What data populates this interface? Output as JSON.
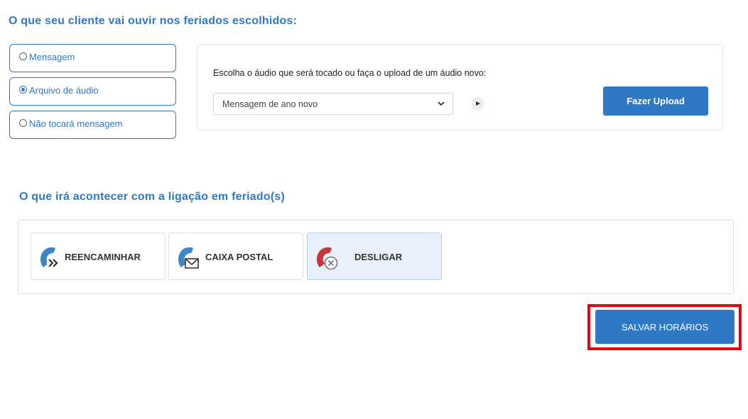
{
  "section_audio": {
    "heading": "O que seu cliente vai ouvir nos feriados escolhidos:",
    "options": [
      {
        "label": "Mensagem",
        "selected": false
      },
      {
        "label": "Arquivo de áudio",
        "selected": true
      },
      {
        "label": "Não tocará mensagem",
        "selected": false
      }
    ],
    "audio_prompt": "Escolha o áudio que será tocado ou faça o upload de um áudio novo:",
    "audio_select_value": "Mensagem de ano novo",
    "upload_label": "Fazer Upload"
  },
  "section_call": {
    "heading": "O que irá acontecer com a ligação em feriado(s)",
    "actions": [
      {
        "label": "REENCAMINHAR",
        "icon": "phone-forward-icon",
        "selected": false
      },
      {
        "label": "CAIXA POSTAL",
        "icon": "phone-mail-icon",
        "selected": false
      },
      {
        "label": "DESLIGAR",
        "icon": "phone-hangup-icon",
        "selected": true
      }
    ]
  },
  "save_label": "SALVAR HORÁRIOS",
  "colors": {
    "accent": "#2f79c4",
    "highlight": "#e3000f",
    "hangup": "#c8343a",
    "selected_bg": "#e8f1fb"
  }
}
